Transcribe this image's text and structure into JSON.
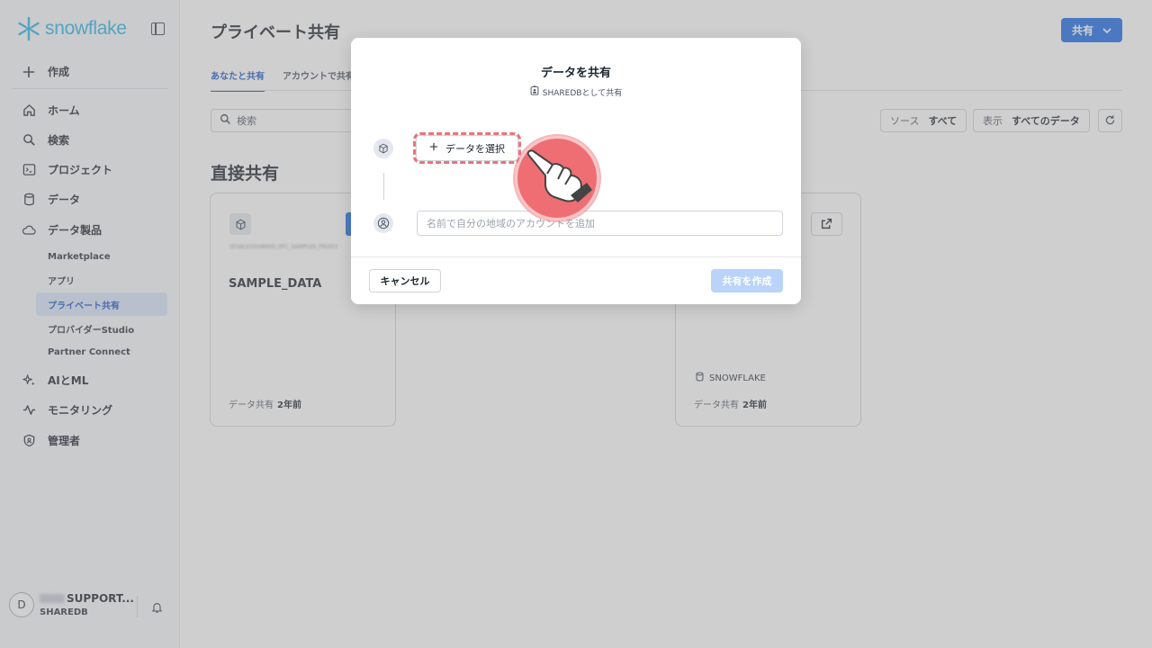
{
  "app": {
    "logo_text": "snowflake"
  },
  "sidebar": {
    "create_label": "作成",
    "items": [
      {
        "label": "ホーム",
        "icon": "home-icon"
      },
      {
        "label": "検索",
        "icon": "search-icon"
      },
      {
        "label": "プロジェクト",
        "icon": "terminal-icon"
      },
      {
        "label": "データ",
        "icon": "database-icon"
      },
      {
        "label": "データ製品",
        "icon": "cloud-icon"
      }
    ],
    "sub_items": [
      {
        "label": "Marketplace"
      },
      {
        "label": "アプリ"
      },
      {
        "label": "プライベート共有",
        "active": true
      },
      {
        "label": "プロバイダーStudio"
      },
      {
        "label": "Partner Connect"
      }
    ],
    "bottom_items": [
      {
        "label": "AIとML",
        "icon": "sparkle-icon"
      },
      {
        "label": "モニタリング",
        "icon": "activity-icon"
      },
      {
        "label": "管理者",
        "icon": "shield-icon"
      }
    ],
    "user": {
      "initial": "D",
      "name_suffix": "SUPPORT...",
      "org": "SHAREDB"
    }
  },
  "header": {
    "title": "プライベート共有",
    "share_button": "共有",
    "tabs": [
      "あなたと共有",
      "アカウントで共有"
    ]
  },
  "toolbar": {
    "search_placeholder": "検索",
    "source_key": "ソース",
    "source_value": "すべて",
    "view_key": "表示",
    "view_value": "すべてのデータ"
  },
  "section": {
    "title": "直接共有"
  },
  "cards": [
    {
      "title": "SAMPLE_DATA",
      "blur_text": "SFSALESSHARED_SFC_SAMPLES_PROD3",
      "footer_key": "データ共有",
      "footer_value": "2年前"
    },
    {
      "source": "SNOWFLAKE",
      "footer_key": "データ共有",
      "footer_value": "2年前"
    }
  ],
  "modal": {
    "title": "データを共有",
    "subtitle": "SHAREDBとして共有",
    "select_data": "データを選択",
    "account_placeholder": "名前で自分の地域のアカウントを追加",
    "cancel": "キャンセル",
    "create": "共有を作成"
  },
  "colors": {
    "primary": "#1a6ce8",
    "brand": "#29b5e8",
    "highlight": "#e8747c",
    "pointer": "#ee6e74"
  }
}
